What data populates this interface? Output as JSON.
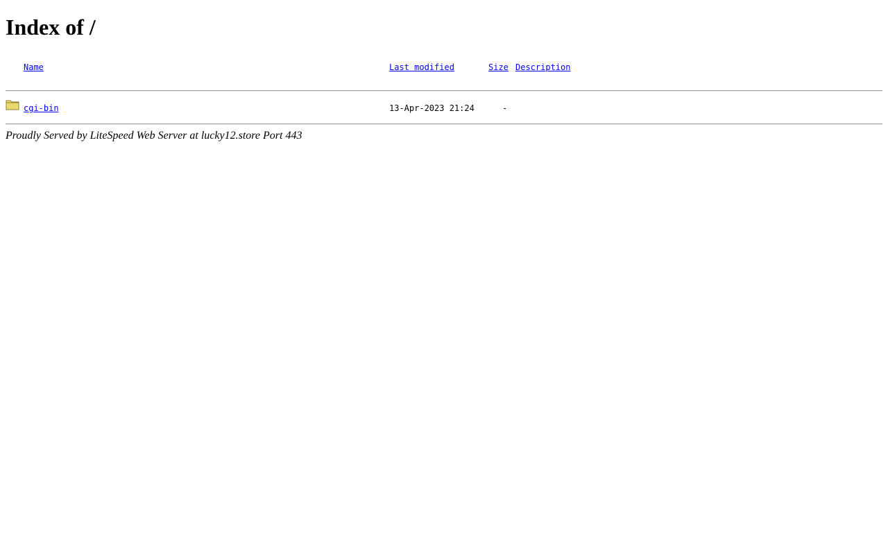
{
  "page": {
    "title": "Index of /"
  },
  "table": {
    "headers": {
      "name": "Name",
      "last_modified": "Last modified",
      "size": "Size",
      "description": "Description"
    },
    "rows": [
      {
        "icon": "folder-icon",
        "name": "cgi-bin",
        "last_modified": "13-Apr-2023 21:24",
        "size": "-",
        "description": ""
      }
    ]
  },
  "footer": {
    "text": "Proudly Served by LiteSpeed Web Server at lucky12.store Port 443"
  },
  "colors": {
    "link": "#0000ee",
    "folder_fill": "#f2e27a",
    "folder_stroke": "#8a7a2a",
    "rule": "#9a9a9a"
  }
}
